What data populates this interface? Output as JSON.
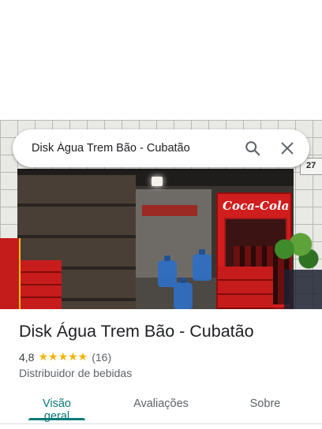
{
  "search": {
    "query": "Disk Água Trem Bão - Cubatão"
  },
  "photo": {
    "sign_text": "Coca-Cola",
    "corner_number": "27"
  },
  "place": {
    "name": "Disk Água Trem Bão - Cubatão",
    "rating": "4,8",
    "stars": "★★★★★",
    "review_count": "(16)",
    "category": "Distribuidor de bebidas"
  },
  "tabs": [
    {
      "label": "Visão geral",
      "active": true
    },
    {
      "label": "Avaliações",
      "active": false
    },
    {
      "label": "Sobre",
      "active": false
    }
  ],
  "colors": {
    "accent": "#0b7a7a",
    "star": "#f4b400"
  },
  "icons": {
    "search": "search-icon",
    "close": "close-icon"
  }
}
